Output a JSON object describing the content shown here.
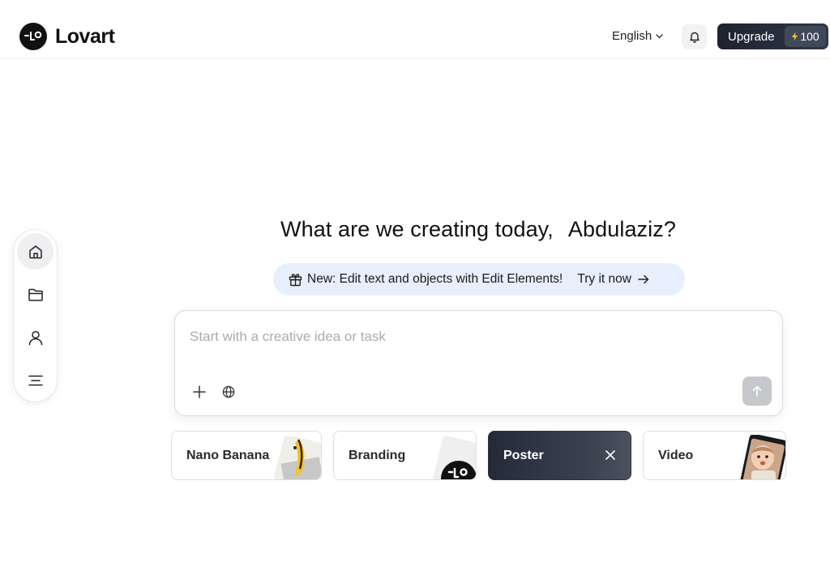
{
  "header": {
    "logo_text": "Lovart",
    "logo_mark": "-LO",
    "language": "English",
    "upgrade_label": "Upgrade",
    "credits": "100"
  },
  "sidebar": {
    "items": [
      {
        "name": "home",
        "icon": "home-icon",
        "active": true
      },
      {
        "name": "projects",
        "icon": "folder-icon",
        "active": false
      },
      {
        "name": "profile",
        "icon": "user-icon",
        "active": false
      },
      {
        "name": "menu",
        "icon": "menu-icon",
        "active": false
      }
    ]
  },
  "main": {
    "greeting_prefix": "What are we creating today,",
    "user_name": "Abdulaziz?",
    "banner_text": "New: Edit text and objects with Edit Elements!",
    "banner_cta": "Try it now",
    "prompt_placeholder": "Start with a creative idea or task"
  },
  "cards": [
    {
      "label": "Nano Banana",
      "selected": false
    },
    {
      "label": "Branding",
      "selected": false
    },
    {
      "label": "Poster",
      "selected": true
    },
    {
      "label": "Video",
      "selected": false
    }
  ],
  "colors": {
    "accent_dark": "#1c2230",
    "banner_bg": "#e7effc",
    "send_disabled": "#c6c8cc"
  }
}
